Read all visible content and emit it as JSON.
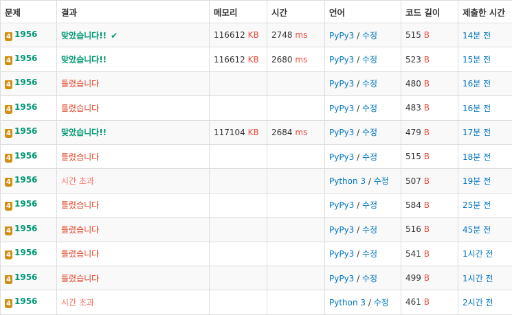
{
  "columns": [
    "문제",
    "결과",
    "메모리",
    "시간",
    "언어",
    "코드 길이",
    "제출한 시간"
  ],
  "units": {
    "memory": "KB",
    "time": "ms",
    "code": "B"
  },
  "edit_label": "수정",
  "separator": "/",
  "check_symbol": "✔",
  "rows": [
    {
      "tier": "4",
      "problem": "1956",
      "result": "맞았습니다!!",
      "result_type": "ac",
      "check": true,
      "memory": "116612",
      "time": "2748",
      "lang": "PyPy3",
      "code": "515",
      "submitted": "14분 전"
    },
    {
      "tier": "4",
      "problem": "1956",
      "result": "맞았습니다!!",
      "result_type": "ac",
      "check": false,
      "memory": "116612",
      "time": "2680",
      "lang": "PyPy3",
      "code": "523",
      "submitted": "15분 전"
    },
    {
      "tier": "4",
      "problem": "1956",
      "result": "틀렸습니다",
      "result_type": "wa",
      "check": false,
      "memory": "",
      "time": "",
      "lang": "PyPy3",
      "code": "480",
      "submitted": "16분 전"
    },
    {
      "tier": "4",
      "problem": "1956",
      "result": "틀렸습니다",
      "result_type": "wa",
      "check": false,
      "memory": "",
      "time": "",
      "lang": "PyPy3",
      "code": "483",
      "submitted": "16분 전"
    },
    {
      "tier": "4",
      "problem": "1956",
      "result": "맞았습니다!!",
      "result_type": "ac",
      "check": false,
      "memory": "117104",
      "time": "2684",
      "lang": "PyPy3",
      "code": "479",
      "submitted": "17분 전"
    },
    {
      "tier": "4",
      "problem": "1956",
      "result": "틀렸습니다",
      "result_type": "wa",
      "check": false,
      "memory": "",
      "time": "",
      "lang": "PyPy3",
      "code": "515",
      "submitted": "18분 전"
    },
    {
      "tier": "4",
      "problem": "1956",
      "result": "시간 초과",
      "result_type": "tle",
      "check": false,
      "memory": "",
      "time": "",
      "lang": "Python 3",
      "code": "507",
      "submitted": "19분 전"
    },
    {
      "tier": "4",
      "problem": "1956",
      "result": "틀렸습니다",
      "result_type": "wa",
      "check": false,
      "memory": "",
      "time": "",
      "lang": "PyPy3",
      "code": "584",
      "submitted": "25분 전"
    },
    {
      "tier": "4",
      "problem": "1956",
      "result": "틀렸습니다",
      "result_type": "wa",
      "check": false,
      "memory": "",
      "time": "",
      "lang": "PyPy3",
      "code": "516",
      "submitted": "45분 전"
    },
    {
      "tier": "4",
      "problem": "1956",
      "result": "틀렸습니다",
      "result_type": "wa",
      "check": false,
      "memory": "",
      "time": "",
      "lang": "PyPy3",
      "code": "541",
      "submitted": "1시간 전"
    },
    {
      "tier": "4",
      "problem": "1956",
      "result": "틀렸습니다",
      "result_type": "wa",
      "check": false,
      "memory": "",
      "time": "",
      "lang": "PyPy3",
      "code": "499",
      "submitted": "1시간 전"
    },
    {
      "tier": "4",
      "problem": "1956",
      "result": "시간 초과",
      "result_type": "tle",
      "check": false,
      "memory": "",
      "time": "",
      "lang": "Python 3",
      "code": "461",
      "submitted": "2시간 전"
    }
  ]
}
